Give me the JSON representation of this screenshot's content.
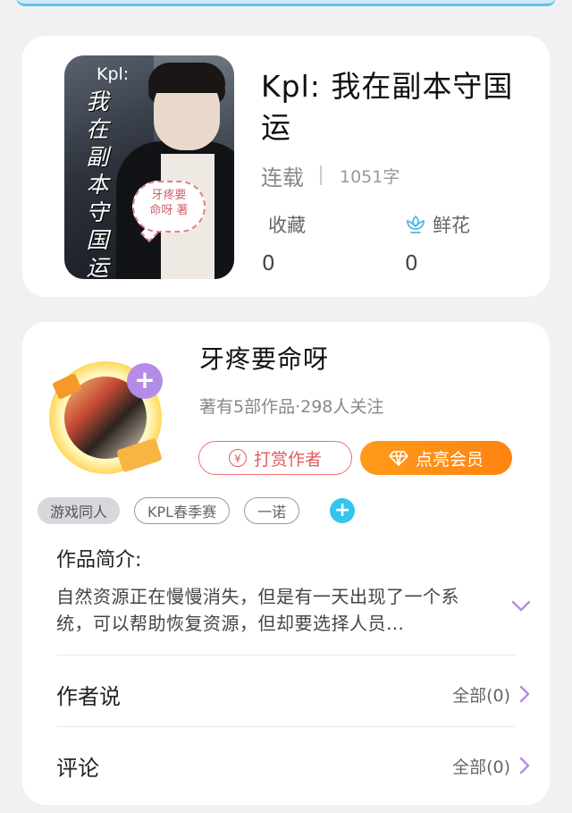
{
  "book": {
    "cover": {
      "prefix": "Kpl:",
      "vertical_title": "我在副本守国运",
      "bubble_line1": "牙疼要",
      "bubble_line2": "命呀 著"
    },
    "title": "Kpl: 我在副本守国运",
    "status": "连载",
    "word_count": "1051字",
    "favorites_label": "收藏",
    "favorites_value": "0",
    "flowers_label": "鲜花",
    "flowers_value": "0"
  },
  "author": {
    "name": "牙疼要命呀",
    "stats": "著有5部作品·298人关注",
    "reward_label": "打赏作者",
    "vip_label": "点亮会员",
    "tags": [
      "游戏同人",
      "KPL春季赛",
      "一诺"
    ],
    "intro_label": "作品简介:",
    "intro_text": "自然资源正在慢慢消失，但是有一天出现了一个系统，可以帮助恢复资源，但却要选择人员…",
    "author_says_label": "作者说",
    "author_says_count": "全部(0)",
    "comments_label": "评论",
    "comments_count": "全部(0)"
  },
  "colors": {
    "vip_orange": "#ff8c15",
    "reward_red": "#e35b60",
    "accent_purple": "#b58be8",
    "tag_add_blue": "#35c4ee"
  }
}
